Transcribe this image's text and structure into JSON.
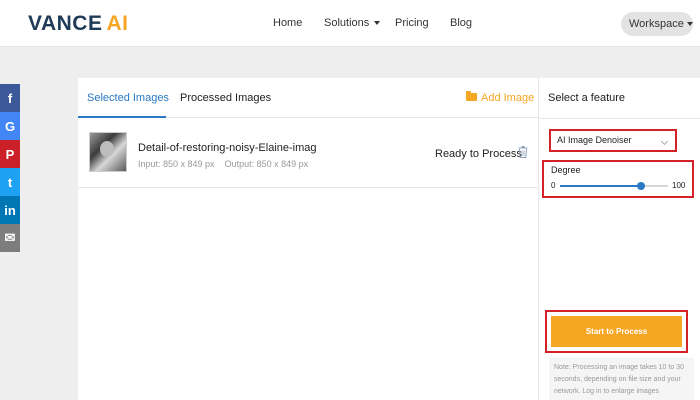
{
  "header": {
    "logo_main": "VANCE",
    "logo_accent": "AI",
    "nav": {
      "home": "Home",
      "solutions": "Solutions",
      "pricing": "Pricing",
      "blog": "Blog"
    },
    "workspace": "Workspace"
  },
  "social": {
    "facebook": "f",
    "google": "G",
    "pinterest": "P",
    "twitter": "t",
    "linkedin": "in",
    "email": "✉"
  },
  "tabs": {
    "selected": "Selected Images",
    "processed": "Processed Images"
  },
  "add_image": "Add Image",
  "file": {
    "name": "Detail-of-restoring-noisy-Elaine-imag",
    "input": "Input: 850 x 849 px",
    "output": "Output: 850 x 849 px",
    "status": "Ready to Process"
  },
  "feature_panel": {
    "title": "Select a feature",
    "selected_feature": "AI Image Denoiser",
    "degree_label": "Degree",
    "min": "0",
    "max": "100",
    "degree_value": 75,
    "start_button": "Start to Process",
    "note": "Note: Processing an image takes 10 to 30 seconds, depending on file size and your network. Log in to enlarge images"
  },
  "colors": {
    "accent_blue": "#2b78c5",
    "accent_orange": "#f5a623",
    "highlight_red": "#d32029"
  }
}
